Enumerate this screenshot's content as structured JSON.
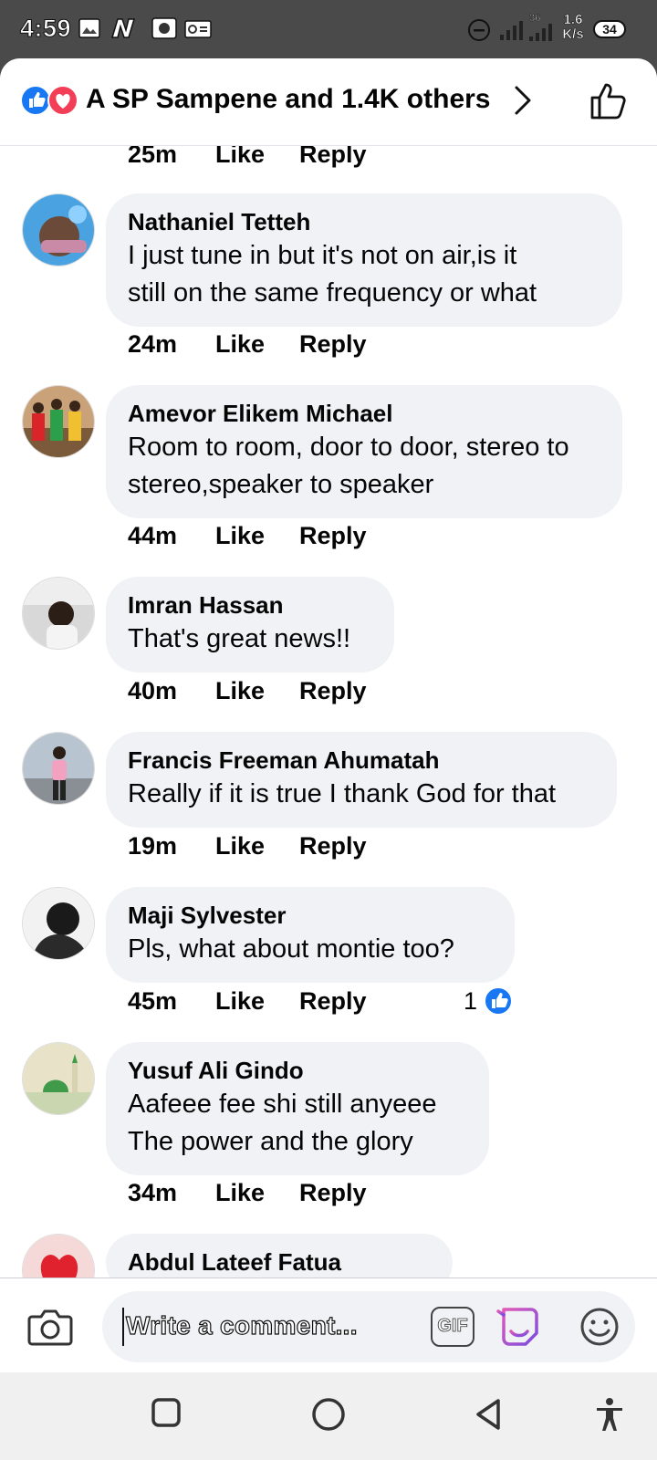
{
  "status_bar": {
    "time": "4:59",
    "network": "36",
    "speed_value": "1.6",
    "speed_unit": "K/s",
    "battery": "34"
  },
  "header": {
    "reactors": "A SP Sampene and 1.4K others"
  },
  "comments": [
    {
      "name": "Nathaniel Tetteh",
      "lines": [
        "I just tune in but it's not on air,is it",
        "still on the same frequency or what"
      ],
      "time": "24m"
    },
    {
      "name": "Amevor Elikem Michael",
      "lines": [
        "Room to room, door to door, stereo to",
        "stereo,speaker to speaker"
      ],
      "time": "44m"
    },
    {
      "name": "Imran Hassan",
      "lines": [
        "That's great news!!"
      ],
      "time": "40m"
    },
    {
      "name": "Francis Freeman Ahumatah",
      "lines": [
        "Really if it is true I thank God for that"
      ],
      "time": "19m"
    },
    {
      "name": "Maji Sylvester",
      "lines": [
        "Pls, what about montie too?"
      ],
      "time": "45m",
      "likes": "1"
    },
    {
      "name": "Yusuf Ali Gindo",
      "lines": [
        "Aafeee fee shi still anyeee",
        "The power and the glory"
      ],
      "time": "34m"
    },
    {
      "name": "Abdul Lateef Fatua",
      "lines": [],
      "time": ""
    }
  ],
  "top_partial": {
    "time": "25m"
  },
  "labels": {
    "like": "Like",
    "reply": "Reply"
  },
  "composer": {
    "placeholder": "Write a comment...",
    "gif_label": "GIF"
  },
  "icons": {
    "like_reaction": "like-reaction-icon",
    "love_reaction": "love-reaction-icon",
    "chevron": "chevron-right-icon",
    "thumb": "thumbs-up-outline-icon",
    "camera": "camera-icon",
    "sticker": "sticker-icon",
    "emoji": "emoji-icon"
  },
  "colors": {
    "facebook_blue": "#1877f2",
    "love_red": "#f33e58",
    "bubble_bg": "#f0f2f5"
  }
}
